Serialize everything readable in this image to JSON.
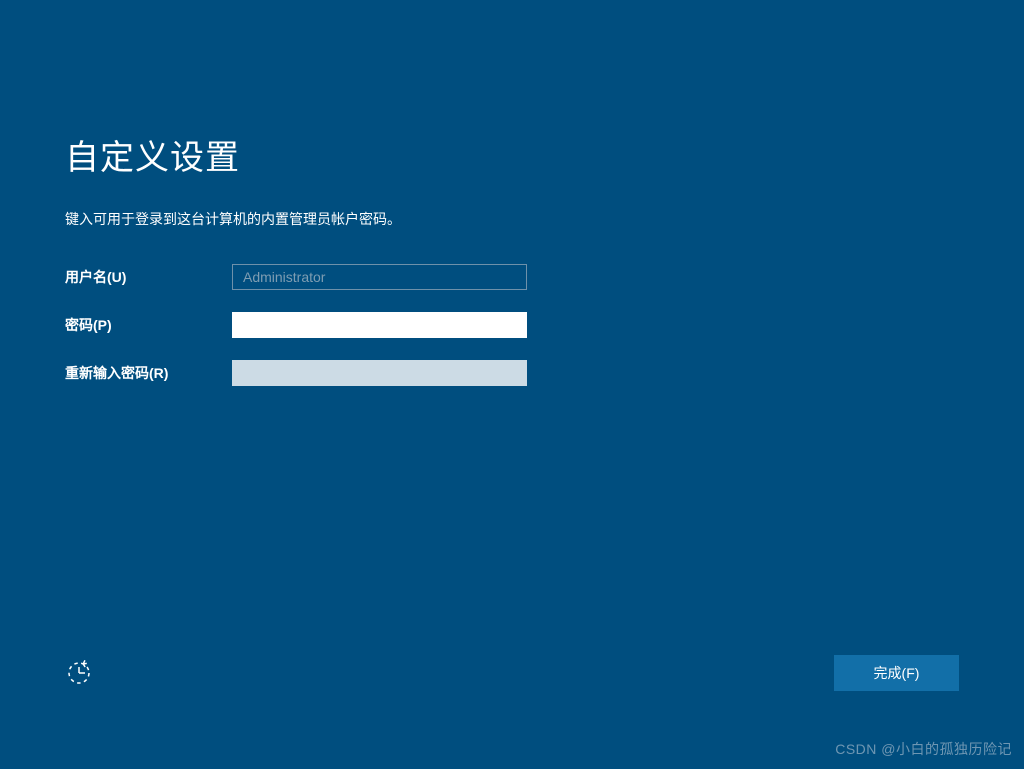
{
  "title": "自定义设置",
  "instruction": "键入可用于登录到这台计算机的内置管理员帐户密码。",
  "form": {
    "username_label": "用户名(U)",
    "username_value": "Administrator",
    "password_label": "密码(P)",
    "password_value": "",
    "reenter_label": "重新输入密码(R)",
    "reenter_value": ""
  },
  "actions": {
    "finish_label": "完成(F)"
  },
  "watermark": "CSDN @小白的孤独历险记"
}
